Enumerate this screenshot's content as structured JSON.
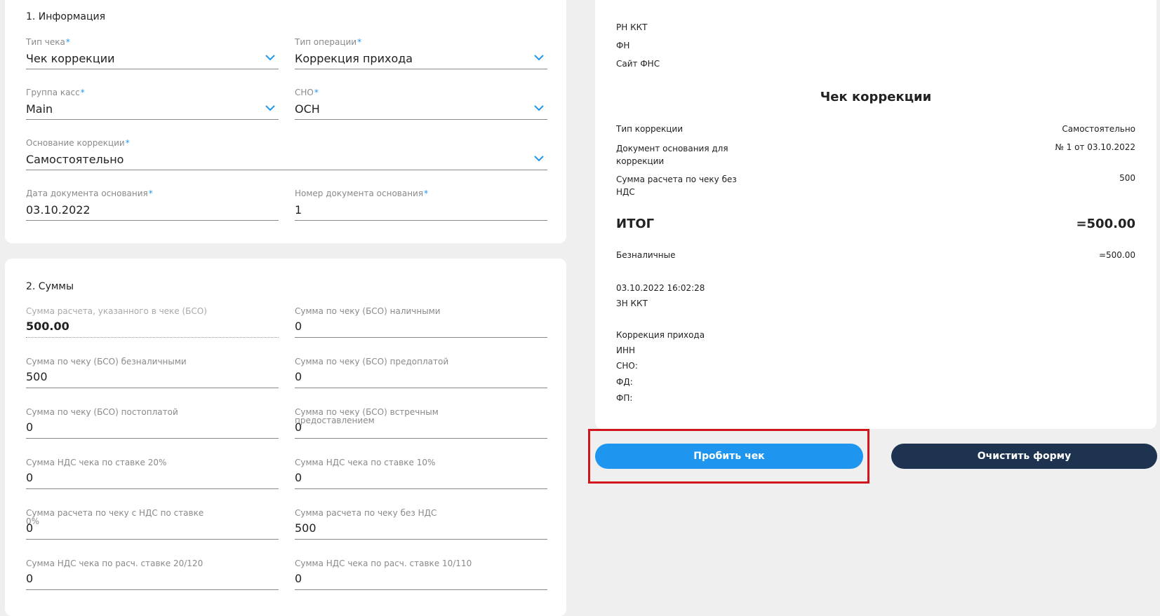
{
  "info": {
    "title": "1. Информация",
    "receipt_type_label": "Тип чека",
    "receipt_type_value": "Чек коррекции",
    "operation_type_label": "Тип операции",
    "operation_type_value": "Коррекция прихода",
    "cash_group_label": "Группа касс",
    "cash_group_value": "Main",
    "sno_label": "СНО",
    "sno_value": "ОСН",
    "correction_basis_label": "Основание коррекции",
    "correction_basis_value": "Самостоятельно",
    "basis_doc_date_label": "Дата документа основания",
    "basis_doc_date_value": "03.10.2022",
    "basis_doc_number_label": "Номер документа основания",
    "basis_doc_number_value": "1",
    "required_mark": "*"
  },
  "sums": {
    "title": "2. Суммы",
    "fields": [
      {
        "label": "Сумма расчета, указанного в чеке (БСО)",
        "value": "500.00"
      },
      {
        "label": "Сумма по чеку (БСО) наличными",
        "value": "0"
      },
      {
        "label": "Сумма по чеку (БСО) безналичными",
        "value": "500"
      },
      {
        "label": "Сумма по чеку (БСО) предоплатой",
        "value": "0"
      },
      {
        "label": "Сумма по чеку (БСО) постоплатой",
        "value": "0"
      },
      {
        "label": "Сумма по чеку (БСО) встречным предоставлением",
        "value": "0"
      },
      {
        "label": "Сумма НДС чека по ставке 20%",
        "value": "0"
      },
      {
        "label": "Сумма НДС чека по ставке 10%",
        "value": "0"
      },
      {
        "label": "Сумма расчета по чеку с НДС по ставке 0%",
        "value": "0"
      },
      {
        "label": "Сумма расчета по чеку без НДС",
        "value": "500"
      },
      {
        "label": "Сумма НДС чека по расч. ставке 20/120",
        "value": "0"
      },
      {
        "label": "Сумма НДС чека по расч. ставке 10/110",
        "value": "0"
      }
    ]
  },
  "receipt": {
    "rn_kkt": "РН ККТ",
    "fn": "ФН",
    "fns_site": "Сайт ФНС",
    "title": "Чек коррекции",
    "correction_type_label": "Тип коррекции",
    "correction_type_value": "Самостоятельно",
    "basis_doc_label": "Документ основания для коррекции",
    "basis_doc_value": "№ 1 от 03.10.2022",
    "sum_no_vat_label": "Сумма расчета по чеку без НДС",
    "sum_no_vat_value": "500",
    "total_label": "ИТОГ",
    "total_value": "=500.00",
    "cashless_label": "Безналичные",
    "cashless_value": "=500.00",
    "datetime": "03.10.2022 16:02:28",
    "zn_kkt": "ЗН ККТ",
    "operation": "Коррекция прихода",
    "inn": "ИНН",
    "sno": "СНО:",
    "fd": "ФД:",
    "fp": "ФП:"
  },
  "actions": {
    "submit_label": "Пробить чек",
    "clear_label": "Очистить форму"
  },
  "colors": {
    "accent": "#1e96f0",
    "dark_button": "#1e3350",
    "highlight": "#d0151c",
    "background": "#efefef"
  }
}
